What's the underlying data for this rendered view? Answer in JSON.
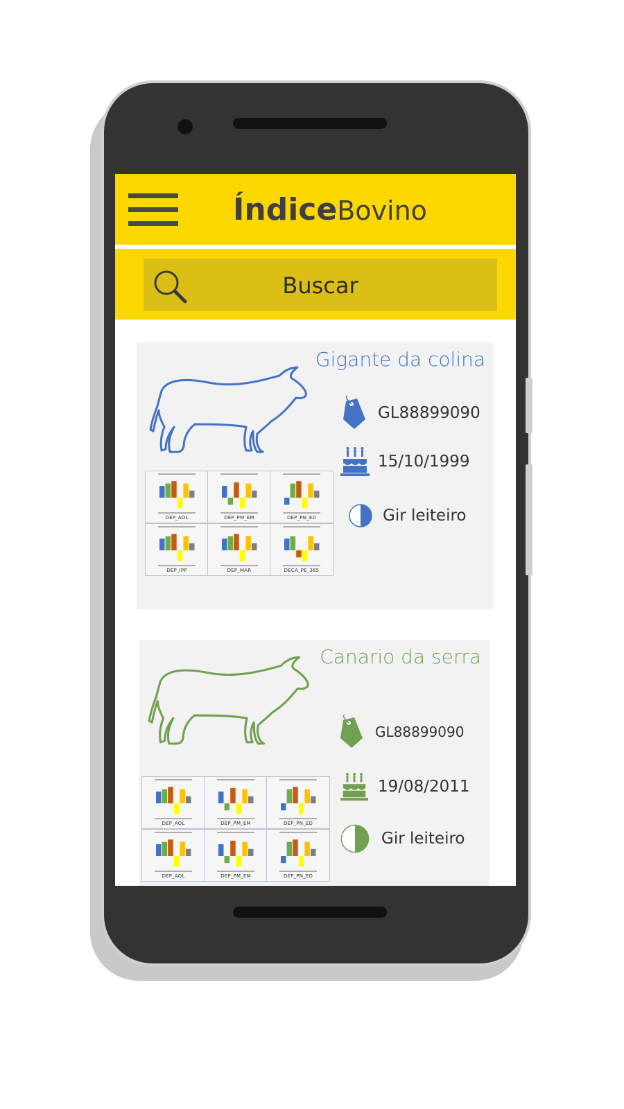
{
  "app": {
    "title_bold": "Índice",
    "title_light": "Bovino"
  },
  "search": {
    "label": "Buscar"
  },
  "colors": {
    "appbar": "#fdd800",
    "search_field": "#dbbf17",
    "card_blue": "#4472c4",
    "card_green": "#70a050",
    "bar_blue": "#4472c4",
    "bar_green": "#70ad47",
    "bar_orange": "#c55a11",
    "bar_yellow": "#ffc000",
    "bar_bright_yellow": "#ffff00",
    "bar_gray": "#7f7f7f"
  },
  "cards": [
    {
      "name": "Gigante da colina",
      "tag": "GL88899090",
      "birth_date": "15/10/1999",
      "breed": "Gir leiteiro",
      "color": "#4472c4",
      "charts": [
        {
          "label": "DEP_AOL",
          "values": [
            0.5,
            0.6,
            0.7,
            -0.45,
            0.6,
            0.3
          ]
        },
        {
          "label": "DEP_PM_EM",
          "values": [
            0.5,
            -0.3,
            0.65,
            -0.45,
            0.6,
            0.3
          ]
        },
        {
          "label": "DEP_PN_ED",
          "values": [
            -0.3,
            0.6,
            0.7,
            -0.45,
            0.6,
            0.3
          ]
        },
        {
          "label": "DEP_IPP",
          "values": [
            0.5,
            0.6,
            0.7,
            -0.45,
            0.6,
            0.3
          ]
        },
        {
          "label": "DEP_MAR",
          "values": [
            0.5,
            0.6,
            0.7,
            -0.45,
            0.6,
            0.3
          ]
        },
        {
          "label": "DECA_PE_365",
          "values": [
            0.5,
            0.6,
            -0.3,
            -0.45,
            0.6,
            0.3
          ]
        }
      ]
    },
    {
      "name": "Canario da serra",
      "tag": "GL88899090",
      "birth_date": "19/08/2011",
      "breed": "Gir leiteiro",
      "color": "#70a050",
      "charts": [
        {
          "label": "DEP_AOL",
          "values": [
            0.5,
            0.6,
            0.7,
            -0.45,
            0.6,
            0.3
          ]
        },
        {
          "label": "DEP_PM_EM",
          "values": [
            0.5,
            -0.3,
            0.65,
            -0.45,
            0.6,
            0.3
          ]
        },
        {
          "label": "DEP_PN_ED",
          "values": [
            -0.3,
            0.6,
            0.7,
            -0.45,
            0.6,
            0.3
          ]
        },
        {
          "label": "DEP_AOL",
          "values": [
            0.5,
            0.6,
            0.7,
            -0.45,
            0.6,
            0.3
          ]
        },
        {
          "label": "DEP_PM_EM",
          "values": [
            0.5,
            -0.3,
            0.65,
            -0.45,
            0.6,
            0.3
          ]
        },
        {
          "label": "DEP_PN_ED",
          "values": [
            -0.3,
            0.6,
            0.7,
            -0.45,
            0.6,
            0.3
          ]
        }
      ]
    }
  ]
}
